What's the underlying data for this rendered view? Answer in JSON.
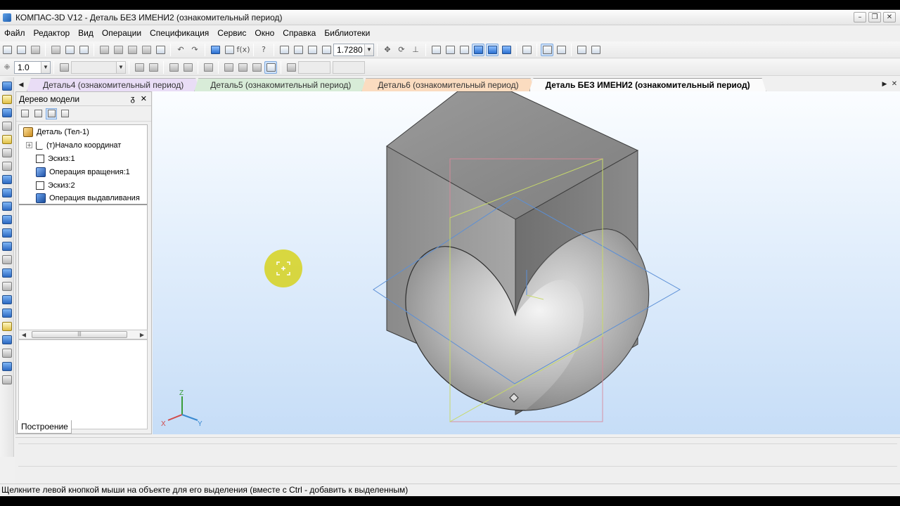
{
  "window": {
    "title": "КОМПАС-3D V12 - Деталь БЕЗ ИМЕНИ2 (ознакомительный период)",
    "controls": [
      "–",
      "❐",
      "✕"
    ]
  },
  "menu": [
    "Файл",
    "Редактор",
    "Вид",
    "Операции",
    "Спецификация",
    "Сервис",
    "Окно",
    "Справка",
    "Библиотеки"
  ],
  "toolbar": {
    "zoom_value": "1.7280",
    "step_value": "1.0"
  },
  "tabs": [
    {
      "label": "Деталь4 (ознакомительный период)",
      "active": false
    },
    {
      "label": "Деталь5 (ознакомительный период)",
      "active": false
    },
    {
      "label": "Деталь6 (ознакомительный период)",
      "active": false
    },
    {
      "label": "Деталь БЕЗ ИМЕНИ2 (ознакомительный период)",
      "active": true
    }
  ],
  "tree_panel": {
    "title": "Дерево модели",
    "pin": "ᵹ",
    "close": "✕",
    "bottom_tab": "Построение",
    "nodes": [
      {
        "label": "Деталь (Тел-1)",
        "icon": "part-icon",
        "level": 0
      },
      {
        "label": "(т)Начало координат",
        "icon": "origin-icon",
        "level": 1,
        "expander": "+"
      },
      {
        "label": "Эскиз:1",
        "icon": "sketch-icon",
        "level": 1
      },
      {
        "label": "Операция вращения:1",
        "icon": "revolve-icon",
        "level": 1
      },
      {
        "label": "Эскиз:2",
        "icon": "sketch-icon",
        "level": 1
      },
      {
        "label": "Операция выдавливания",
        "icon": "extrude-icon",
        "level": 1
      }
    ]
  },
  "viewport": {
    "axis_labels": {
      "x": "X",
      "y": "Y",
      "z": "Z"
    },
    "model_colors": {
      "solid": "#8f8f8f",
      "plane_xy": "#5b8fd6",
      "plane_xz": "#d98a9a",
      "plane_yz": "#c7d96a"
    }
  },
  "status": "Щелкните левой кнопкой мыши на объекте для его выделения (вместе с Ctrl - добавить к выделенным)"
}
